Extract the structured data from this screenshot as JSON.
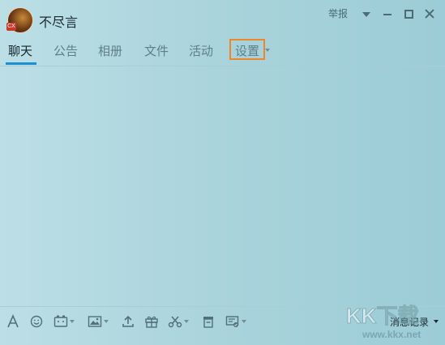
{
  "window": {
    "group_name": "不尽言",
    "avatar_badge": "CX",
    "report_label": "举报",
    "icons": [
      "dropdown-icon",
      "minimize-icon",
      "maximize-icon",
      "close-icon"
    ]
  },
  "tabs": [
    {
      "label": "聊天",
      "active": true
    },
    {
      "label": "公告",
      "active": false
    },
    {
      "label": "相册",
      "active": false
    },
    {
      "label": "文件",
      "active": false
    },
    {
      "label": "活动",
      "active": false
    },
    {
      "label": "设置",
      "active": false,
      "highlighted": true
    }
  ],
  "toolbar": {
    "tools": [
      "font-icon",
      "emoji-icon",
      "gif-icon",
      "image-icon",
      "upload-icon",
      "gift-icon",
      "screenshot-icon",
      "clipboard-icon",
      "send-file-icon"
    ],
    "history_label": "消息记录"
  },
  "watermark": {
    "text": "KK下载",
    "url": "www.kkx.net"
  },
  "colors": {
    "accent": "#1b8fd6",
    "highlight": "#f0862a"
  }
}
